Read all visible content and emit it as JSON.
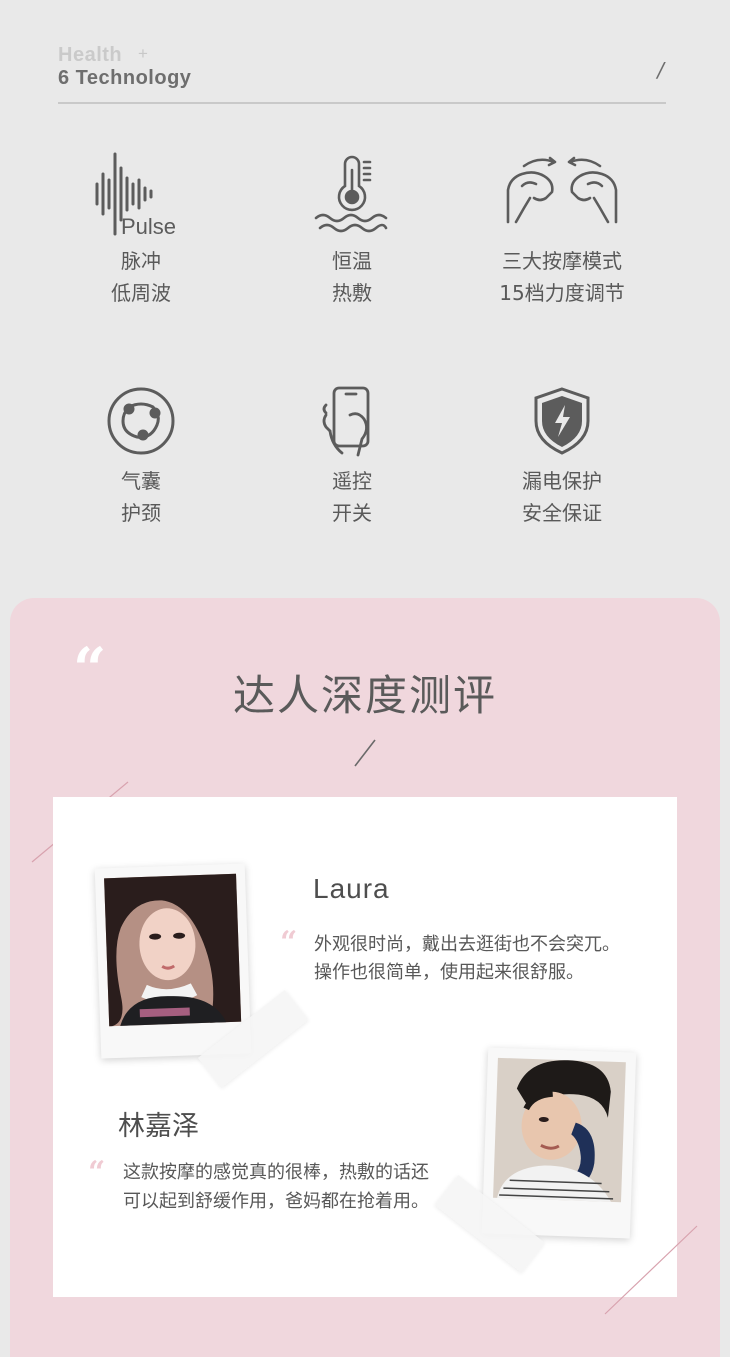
{
  "header": {
    "line1": "Health",
    "plus": "+",
    "line2": "6 Technology",
    "slash": "/"
  },
  "features": [
    {
      "icon": "pulse-wave-icon",
      "icon_text": "Pulse",
      "line1": "脉冲",
      "line2": "低周波"
    },
    {
      "icon": "thermometer-icon",
      "line1": "恒温",
      "line2": "热敷"
    },
    {
      "icon": "massage-hands-icon",
      "line1": "三大按摩模式",
      "line2": "15档力度调节"
    },
    {
      "icon": "airbag-icon",
      "line1": "气囊",
      "line2": "护颈"
    },
    {
      "icon": "remote-phone-icon",
      "line1": "遥控",
      "line2": "开关"
    },
    {
      "icon": "shield-lightning-icon",
      "line1": "漏电保护",
      "line2": "安全保证"
    }
  ],
  "review": {
    "quote_mark": "“",
    "title": "达人深度测评",
    "reviews": [
      {
        "name": "Laura",
        "quote_mark": "“",
        "text": "外观很时尚，戴出去逛街也不会突兀。操作也很简单，使用起来很舒服。"
      },
      {
        "name": "林嘉泽",
        "quote_mark": "“",
        "text": "这款按摩的感觉真的很棒，热敷的话还可以起到舒缓作用，爸妈都在抢着用。"
      }
    ]
  },
  "colors": {
    "background": "#e9e9e9",
    "pink_panel": "#f0d7dd",
    "icon_stroke": "#5c5c5c",
    "text": "#595959",
    "quote_pink": "#f0cbd3"
  }
}
